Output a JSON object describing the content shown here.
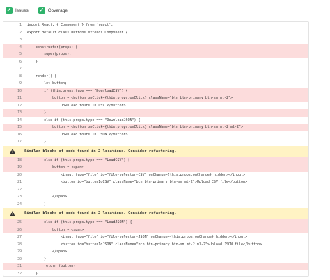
{
  "toolbar": {
    "issues_label": "Issues",
    "coverage_label": "Coverage"
  },
  "colors": {
    "checkbox": "#2fb36b",
    "highlight_line": "#fcdcdc",
    "warning_bg": "#fff3c4"
  },
  "lines": [
    {
      "n": "1",
      "text": "import React, { Component } from 'react';",
      "hl": false
    },
    {
      "n": "2",
      "text": "export default class Buttons extends Component {",
      "hl": false
    },
    {
      "n": "3",
      "text": "",
      "hl": false
    },
    {
      "n": "4",
      "text": "    constructor(props) {",
      "hl": true
    },
    {
      "n": "5",
      "text": "        super(props);",
      "hl": true
    },
    {
      "n": "6",
      "text": "    }",
      "hl": false
    },
    {
      "n": "7",
      "text": "",
      "hl": false
    },
    {
      "n": "8",
      "text": "    render() {",
      "hl": false
    },
    {
      "n": "9",
      "text": "        let button;",
      "hl": false
    },
    {
      "n": "10",
      "text": "        if (this.props.type === \"DownloadCSV\") {",
      "hl": true
    },
    {
      "n": "11",
      "text": "            button = <button onClick={this.props.onClick} className=\"btn btn-primary btn-sm mt-2\">",
      "hl": true
    },
    {
      "n": "12",
      "text": "                Download tours in CSV </button>",
      "hl": false
    },
    {
      "n": "13",
      "text": "        }",
      "hl": true
    },
    {
      "n": "14",
      "text": "        else if (this.props.type === \"DownloadJSON\") {",
      "hl": false
    },
    {
      "n": "15",
      "text": "            button = <button onClick={this.props.onClick} className=\"btn btn-primary btn-sm mt-2 ml-2\">",
      "hl": true
    },
    {
      "n": "16",
      "text": "                Download tours in JSON </button>",
      "hl": false
    },
    {
      "n": "17",
      "text": "        }",
      "hl": false
    }
  ],
  "warning1": "Similar blocks of code found in 2 locations. Consider refactoring.",
  "lines2": [
    {
      "n": "18",
      "text": "        else if (this.props.type === \"LoadCSV\") {",
      "hl": true
    },
    {
      "n": "19",
      "text": "            button = <span>",
      "hl": true
    },
    {
      "n": "20",
      "text": "                <input type=\"file\" id=\"file-selector-CSV\" onChange={this.props.onChange} hidden></input>",
      "hl": false
    },
    {
      "n": "21",
      "text": "                <button id=\"buttonIdCSV\" className=\"btn btn-primary btn-sm mt-2\">Upload CSV file</button>",
      "hl": false
    },
    {
      "n": "22",
      "text": "",
      "hl": false
    },
    {
      "n": "23",
      "text": "            </span>",
      "hl": false
    },
    {
      "n": "24",
      "text": "        }",
      "hl": false
    }
  ],
  "warning2": "Similar blocks of code found in 2 locations. Consider refactoring.",
  "lines3": [
    {
      "n": "25",
      "text": "        else if (this.props.type === \"LoadJSON\") {",
      "hl": true
    },
    {
      "n": "26",
      "text": "            button = <span>",
      "hl": true
    },
    {
      "n": "27",
      "text": "                <input type=\"file\" id=\"file-selector-JSON\" onChange={this.props.onChange} hidden></input>",
      "hl": false
    },
    {
      "n": "28",
      "text": "                <button id=\"buttonIdJSON\" className=\"btn btn-primary btn-sm mt-2 ml-2\">Upload JSON file</button>",
      "hl": false
    },
    {
      "n": "29",
      "text": "            </span>",
      "hl": false
    },
    {
      "n": "30",
      "text": "        }",
      "hl": false
    },
    {
      "n": "31",
      "text": "        return (button)",
      "hl": true
    },
    {
      "n": "32",
      "text": "    }",
      "hl": false
    },
    {
      "n": "33",
      "text": "}",
      "hl": false
    }
  ]
}
